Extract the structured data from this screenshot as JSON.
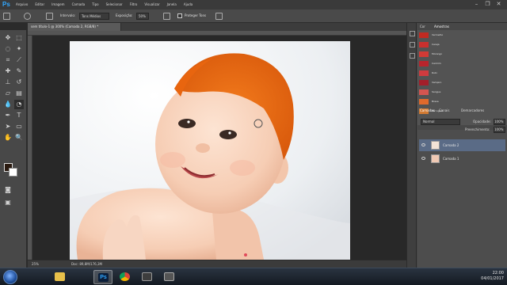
{
  "app": {
    "logo": "Ps"
  },
  "menu": [
    "Arquivo",
    "Editar",
    "Imagem",
    "Camada",
    "Tipo",
    "Selecionar",
    "Filtro",
    "Visualizar",
    "Janela",
    "Ajuda"
  ],
  "window_buttons": [
    "minimize-icon",
    "restore-icon",
    "close-icon"
  ],
  "options_bar": {
    "interval_label": "Intervalo:",
    "interval_value": "Tons Médios",
    "exposure_label": "Exposição:",
    "exposure_value": "50%",
    "protect_label": "Proteger Tons"
  },
  "document": {
    "tab_label": "sem título-1 @ 300% (Camada 2, RGB/8) *",
    "zoom": "25%",
    "doc_info": "Doc: 89,8M/176,3M"
  },
  "swatches_panel": {
    "tabs": [
      "Cor",
      "Amostras"
    ],
    "items": [
      {
        "name": "Vermelho",
        "color": "#c12a22"
      },
      {
        "name": "Cereja",
        "color": "#c9302e"
      },
      {
        "name": "Morango",
        "color": "#d23a35"
      },
      {
        "name": "Carmim",
        "color": "#b8242c"
      },
      {
        "name": "Rubi",
        "color": "#cf3b3f"
      },
      {
        "name": "Vampiro",
        "color": "#a41f2a"
      },
      {
        "name": "Sangue",
        "color": "#d45550"
      },
      {
        "name": "Brasa",
        "color": "#e06a2c"
      },
      {
        "name": "Ferrugem",
        "color": "#d27a32"
      }
    ]
  },
  "layers_panel": {
    "tabs": [
      "Camadas",
      "Canais",
      "Demarcadores"
    ],
    "blend_mode": "Normal",
    "opacity_label": "Opacidade:",
    "opacity_value": "100%",
    "fill_label": "Preenchimento:",
    "fill_value": "100%",
    "layers": [
      {
        "name": "Camada 2",
        "selected": true
      },
      {
        "name": "Camada 1",
        "selected": false
      }
    ]
  },
  "taskbar": {
    "apps": [
      "explorer-icon",
      "photoshop-icon",
      "chrome-icon",
      "screen-recorder-icon",
      "media-icon"
    ],
    "time": "22:00",
    "date": "04/01/2017"
  }
}
